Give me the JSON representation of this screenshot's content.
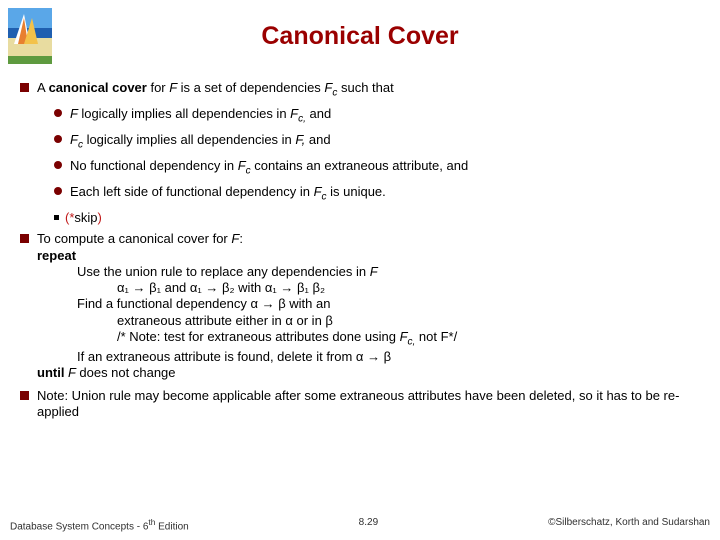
{
  "title": "Canonical Cover",
  "b1_a": "A ",
  "b1_b": "canonical cover ",
  "b1_c": "for ",
  "b1_d": "F ",
  "b1_e": "is a set of dependencies ",
  "b1_f": "F",
  "b1_g": "c",
  "b1_h": " such that",
  "s1_a": "F ",
  "s1_b": "logically implies all dependencies in ",
  "s1_c": "F",
  "s1_d": "c,",
  "s1_e": " and",
  "s2_a": "F",
  "s2_b": "c",
  "s2_c": " logically implies all dependencies in ",
  "s2_d": "F, ",
  "s2_e": "and",
  "s3_a": "No functional dependency in ",
  "s3_b": "F",
  "s3_c": "c",
  "s3_d": " contains an extraneous attribute, and",
  "s4_a": "Each left side of functional dependency in ",
  "s4_b": "F",
  "s4_c": "c",
  "s4_d": " is unique.",
  "skip_a": "(*",
  "skip_b": "skip",
  "skip_c": ")",
  "b2_a": "To compute a canonical cover for ",
  "b2_b": "F",
  "b2_c": ":",
  "alg_repeat": "repeat",
  "alg_l1": "Use the union rule to replace any dependencies in ",
  "alg_l1_f": "F",
  "alg_l2": "α₁ → β₁ and α₁ → β₂ with α₁ → β₁ β₂",
  "alg_l3": "Find a functional dependency α → β with an",
  "alg_l4": "extraneous attribute either in α or in β",
  "alg_l5a": "/* Note: test for extraneous attributes done using ",
  "alg_l5b": "F",
  "alg_l5c": "c,",
  "alg_l5d": " not F*/",
  "alg_l6": "If an extraneous attribute is found, delete it from α → β",
  "alg_until_a": "until",
  "alg_until_b": " F ",
  "alg_until_c": "does not change",
  "b3": "Note: Union rule may become applicable after some extraneous attributes have been deleted, so it has to be re-applied",
  "footer_left_a": "Database System Concepts - 6",
  "footer_left_b": "th",
  "footer_left_c": " Edition",
  "footer_center": "8.29",
  "footer_right": "©Silberschatz, Korth and Sudarshan"
}
